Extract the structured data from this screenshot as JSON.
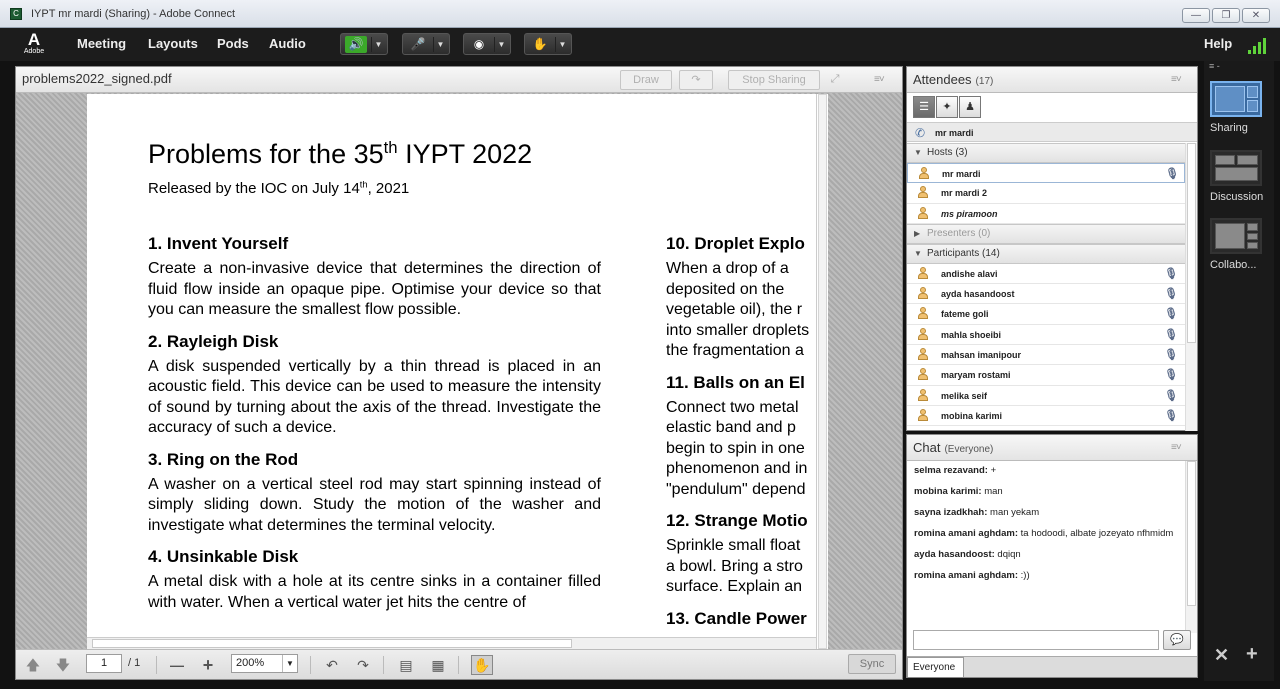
{
  "window": {
    "title": "IYPT mr mardi (Sharing) - Adobe Connect",
    "app_icon": "adobe-connect-icon",
    "controls": [
      "minimize",
      "maximize",
      "close"
    ]
  },
  "menubar": {
    "logo_text": "Adobe",
    "items": [
      "Meeting",
      "Layouts",
      "Pods",
      "Audio"
    ],
    "help": "Help",
    "speaker_color": "#5fd33b",
    "signal_color": "#5fd33b"
  },
  "share_pod": {
    "filename": "problems2022_signed.pdf",
    "draw_label": "Draw",
    "stop_sharing_label": "Stop Sharing",
    "document": {
      "title_pre": "Problems for the 35",
      "title_sup": "th",
      "title_post": " IYPT 2022",
      "released_pre": "Released by the IOC on July 14",
      "released_sup": "th",
      "released_post": ", 2021",
      "col1": [
        {
          "h": "1. Invent Yourself",
          "p": "Create a non-invasive device that determines the direction of fluid flow inside an opaque pipe. Optimise your device so that you can measure the smallest flow possible."
        },
        {
          "h": "2. Rayleigh Disk",
          "p": "A disk suspended vertically by a thin thread is placed in an acoustic field. This device can be used to measure the intensity of sound by turning about the axis of the thread. Investigate the accuracy of such a device."
        },
        {
          "h": "3. Ring on the Rod",
          "p": "A washer on a vertical steel rod may start spinning instead of simply sliding down. Study the motion of the washer and investigate what determines the terminal velocity."
        },
        {
          "h": "4. Unsinkable Disk",
          "p": "A metal disk with a hole at its centre sinks in a container filled with water. When a vertical water jet hits the centre of"
        }
      ],
      "col2": [
        {
          "h": "10. Droplet Explo",
          "lines": [
            "When a drop of a",
            "deposited on the",
            "vegetable oil), the r",
            "into smaller droplets",
            "the fragmentation a"
          ]
        },
        {
          "h": "11. Balls on an El",
          "lines": [
            "Connect two metal",
            "elastic band and p",
            "begin to spin in one",
            "phenomenon and in",
            "\"pendulum\" depend"
          ]
        },
        {
          "h": "12. Strange Motio",
          "lines": [
            "Sprinkle small float",
            "a bowl. Bring a stro",
            "surface. Explain an"
          ]
        },
        {
          "h": "13. Candle Power",
          "lines": []
        }
      ]
    },
    "toolbar": {
      "page_current": "1",
      "page_total": "/ 1",
      "zoom": "200%",
      "sync_label": "Sync"
    }
  },
  "attendees": {
    "title": "Attendees",
    "count": "(17)",
    "self": "mr mardi",
    "groups": [
      {
        "label": "Hosts (3)",
        "expanded": true,
        "members": [
          "mr mardi",
          "mr mardi 2",
          "ms piramoon"
        ]
      },
      {
        "label": "Presenters (0)",
        "expanded": false,
        "members": []
      },
      {
        "label": "Participants (14)",
        "expanded": true,
        "members": [
          "andishe alavi",
          "ayda hasandoost",
          "fateme goli",
          "mahla shoeibi",
          "mahsan imanipour",
          "maryam rostami",
          "melika seif",
          "mobina karimi"
        ]
      }
    ]
  },
  "chat": {
    "title": "Chat",
    "scope": "(Everyone)",
    "messages": [
      {
        "sender": "selma rezavand:",
        "text": "+"
      },
      {
        "sender": "mobina karimi:",
        "text": "man"
      },
      {
        "sender": "sayna izadkhah:",
        "text": "man yekam"
      },
      {
        "sender": "romina amani aghdam:",
        "text": "ta hodoodi, albate jozeyato nfhmidm"
      },
      {
        "sender": "ayda hasandoost:",
        "text": "dqiqn"
      },
      {
        "sender": "romina amani aghdam:",
        "text": ":))"
      }
    ],
    "tab": "Everyone"
  },
  "layouts": {
    "items": [
      "Sharing",
      "Discussion",
      "Collabo..."
    ],
    "active": "Sharing"
  }
}
